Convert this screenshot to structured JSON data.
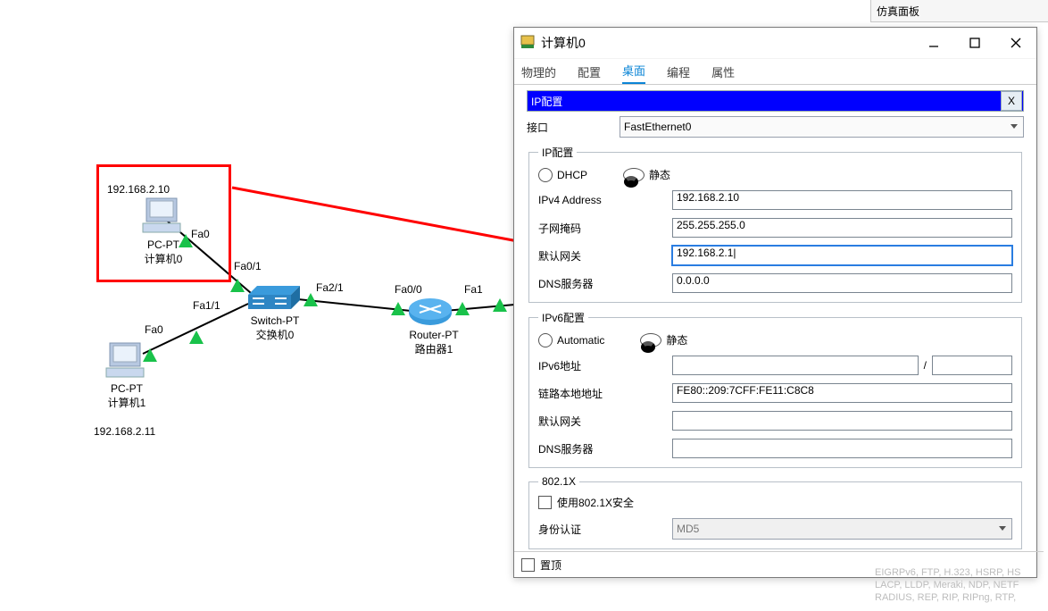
{
  "side_panel_title": "仿真面板",
  "window": {
    "title": "计算机0"
  },
  "tabs": [
    "物理的",
    "配置",
    "桌面",
    "编程",
    "属性"
  ],
  "active_tab": "桌面",
  "ipcfg_bar": {
    "title": "IP配置",
    "close": "X"
  },
  "iface": {
    "label": "接口",
    "value": "FastEthernet0"
  },
  "v4": {
    "legend": "IP配置",
    "dhcp": "DHCP",
    "static": "静态",
    "ipv4_label": "IPv4 Address",
    "ipv4_value": "192.168.2.10",
    "mask_label": "子网掩码",
    "mask_value": "255.255.255.0",
    "gw_label": "默认网关",
    "gw_value": "192.168.2.1|",
    "dns_label": "DNS服务器",
    "dns_value": "0.0.0.0"
  },
  "v6": {
    "legend": "IPv6配置",
    "auto": "Automatic",
    "static": "静态",
    "addr_label": "IPv6地址",
    "addr_value": "",
    "prefix_value": "",
    "ll_label": "链路本地地址",
    "ll_value": "FE80::209:7CFF:FE11:C8C8",
    "gw_label": "默认网关",
    "gw_value": "",
    "dns_label": "DNS服务器",
    "dns_value": ""
  },
  "dot1x": {
    "legend": "802.1X",
    "use": "使用802.1X安全",
    "auth_label": "身份认证",
    "auth_value": "MD5"
  },
  "top_checkbox": "置顶",
  "topology": {
    "pc0_ip": "192.168.2.10",
    "pc0_name1": "PC-PT",
    "pc0_name2": "计算机0",
    "pc1_ip": "192.168.2.11",
    "pc1_name1": "PC-PT",
    "pc1_name2": "计算机1",
    "sw_name1": "Switch-PT",
    "sw_name2": "交换机0",
    "rt_name1": "Router-PT",
    "rt_name2": "路由器1",
    "ports": {
      "pc0": "Fa0",
      "pc1": "Fa0",
      "swf01": "Fa0/1",
      "swf11": "Fa1/1",
      "swf21": "Fa2/1",
      "rt00": "Fa0/0",
      "rtfa1": "Fa1"
    }
  },
  "proto_hint1": "EIGRPv6, FTP, H.323, HSRP, HS",
  "proto_hint2": "LACP, LLDP, Meraki, NDP, NETF",
  "proto_hint3": "RADIUS, REP, RIP, RIPng, RTP,"
}
